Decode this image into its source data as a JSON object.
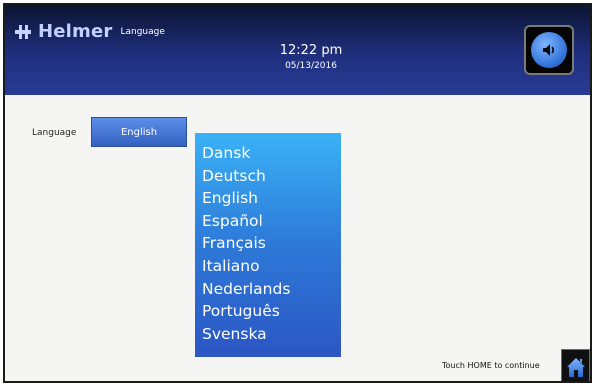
{
  "header": {
    "brand": "Helmer",
    "screen_title": "Language",
    "time": "12:22 pm",
    "date": "05/13/2016",
    "sound_icon": "speaker-icon"
  },
  "language": {
    "label": "Language",
    "selected": "English",
    "options": [
      "Dansk",
      "Deutsch",
      "English",
      "Español",
      "Français",
      "Italiano",
      "Nederlands",
      "Português",
      "Svenska"
    ]
  },
  "footer": {
    "continue_text": "Touch HOME to continue",
    "home_icon": "home-icon"
  },
  "colors": {
    "header_dark": "#0b1430",
    "header_blue": "#283c95",
    "button_blue": "#3361c0",
    "dropdown_top": "#3ab2f6",
    "dropdown_bottom": "#2c56c4"
  }
}
